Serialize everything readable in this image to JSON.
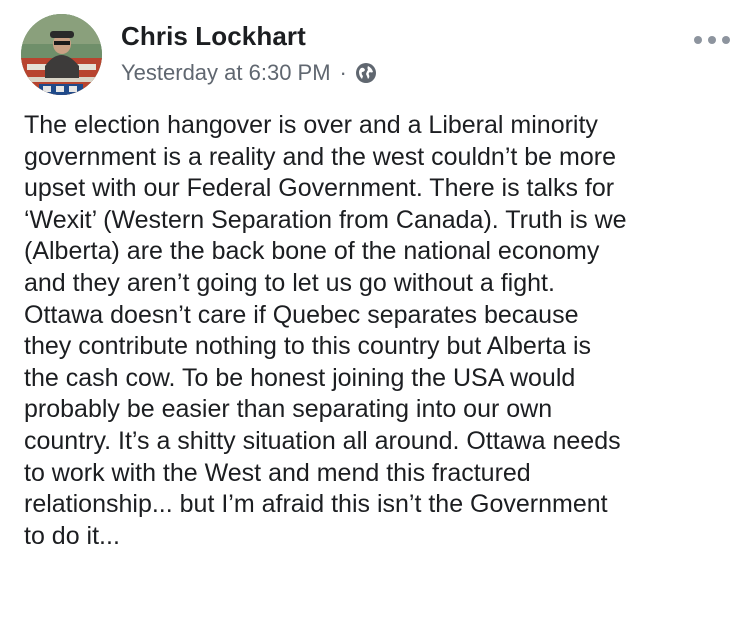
{
  "post": {
    "author": "Chris Lockhart",
    "timestamp": "Yesterday at 6:30 PM",
    "separator": "·",
    "privacy_icon": "globe-icon",
    "more_icon": "more-options-icon",
    "body_lines": [
      "The election hangover is over and a Liberal minority",
      "government is a reality and the west couldn’t be more",
      "upset with our Federal Government. There is talks for",
      "‘Wexit’ (Western Separation from Canada). Truth is we",
      "(Alberta) are the back bone of the national economy",
      "and they aren’t going to let us go without a fight.",
      "Ottawa doesn’t care if Quebec separates because",
      "they contribute nothing to this country but Alberta is",
      "the cash cow. To be honest joining the USA would",
      "probably be easier than separating into our own",
      "country. It’s a shitty situation all around. Ottawa needs",
      "to work with the West and mend this fractured",
      "relationship... but I’m afraid this isn’t the Government",
      "to do it..."
    ]
  },
  "colors": {
    "text_primary": "#1c1e21",
    "text_secondary": "#606770",
    "icon_gray": "#8d949e"
  }
}
